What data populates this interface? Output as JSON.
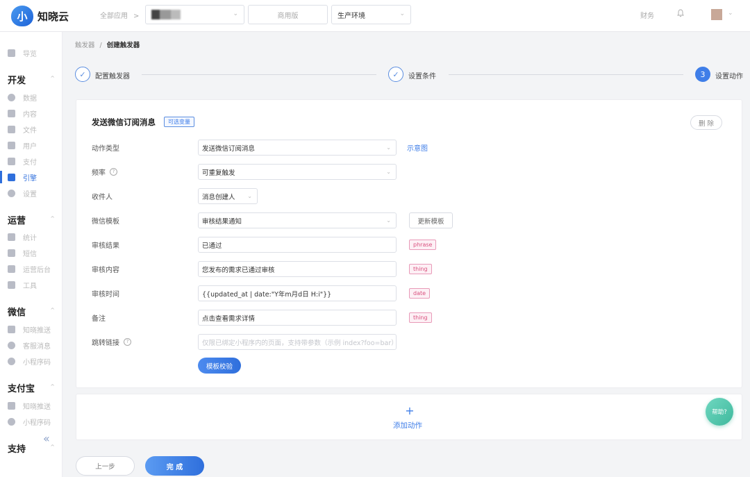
{
  "header": {
    "logo_mark": "小",
    "logo_text": "知晓云",
    "all_apps": "全部应用",
    "all_apps_chevron": ">",
    "edition": "商用版",
    "environment": "生产环境",
    "finance": "财务"
  },
  "sidebar": {
    "overview": "导览",
    "groups": [
      {
        "title": "开发",
        "items": [
          "数据",
          "内容",
          "文件",
          "用户",
          "支付",
          "引擎",
          "设置"
        ]
      },
      {
        "title": "运营",
        "items": [
          "统计",
          "短信",
          "运营后台",
          "工具"
        ]
      },
      {
        "title": "微信",
        "items": [
          "知晓推送",
          "客服消息",
          "小程序码"
        ]
      },
      {
        "title": "支付宝",
        "items": [
          "知晓推送",
          "小程序码"
        ]
      },
      {
        "title": "支持",
        "items": []
      }
    ],
    "active_item": "引擎",
    "collapse_icon": "«"
  },
  "breadcrumb": {
    "parent": "触发器",
    "separator": "/",
    "current": "创建触发器"
  },
  "steps": [
    {
      "label": "配置触发器",
      "marker": "✓",
      "state": "done"
    },
    {
      "label": "设置条件",
      "marker": "✓",
      "state": "done"
    },
    {
      "label": "设置动作",
      "marker": "3",
      "state": "current"
    }
  ],
  "action_card": {
    "title": "发送微信订阅消息",
    "variables_badge": "可选变量",
    "delete_label": "删 除",
    "rows": {
      "action_type": {
        "label": "动作类型",
        "value": "发送微信订阅消息",
        "link": "示意图"
      },
      "frequency": {
        "label": "频率",
        "value": "可重复触发"
      },
      "recipient": {
        "label": "收件人",
        "value": "消息创建人"
      },
      "template": {
        "label": "微信模板",
        "value": "审核结果通知",
        "button": "更新模板"
      },
      "result": {
        "label": "审核结果",
        "value": "已通过",
        "tag": "phrase"
      },
      "content": {
        "label": "审核内容",
        "value": "您发布的需求已通过审核",
        "tag": "thing"
      },
      "time": {
        "label": "审核时间",
        "value": "{{updated_at | date:\"Y年m月d日 H:i\"}}",
        "tag": "date"
      },
      "remark": {
        "label": "备注",
        "value": "点击查看需求详情",
        "tag": "thing"
      },
      "jump_link": {
        "label": "跳转链接",
        "placeholder": "仅限已绑定小程序内的页面，支持带参数（示例 index?foo=bar）"
      }
    },
    "validate_label": "模板校验"
  },
  "add_action": {
    "plus": "+",
    "label": "添加动作"
  },
  "help_fab": "帮助?",
  "footer": {
    "prev_label": "上一步",
    "finish_label": "完 成"
  },
  "colors": {
    "primary": "#2f6fdc",
    "tag_pink": "#d9507e",
    "help_green": "#3fb99d"
  }
}
